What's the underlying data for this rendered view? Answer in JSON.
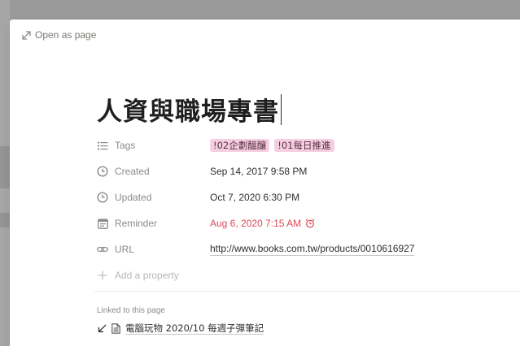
{
  "modal": {
    "open_as_page_label": "Open as page",
    "title": "人資與職場專書"
  },
  "properties": [
    {
      "name": "Tags",
      "icon": "list-icon"
    },
    {
      "name": "Created",
      "icon": "clock-icon",
      "value": "Sep 14, 2017 9:58 PM"
    },
    {
      "name": "Updated",
      "icon": "clock-icon",
      "value": "Oct 7, 2020 6:30 PM"
    },
    {
      "name": "Reminder",
      "icon": "calendar-icon",
      "value": "Aug 6, 2020 7:15 AM"
    },
    {
      "name": "URL",
      "icon": "link-icon",
      "value": "http://www.books.com.tw/products/0010616927"
    }
  ],
  "tags": [
    "!02企劃醞釀",
    "!01每日推進"
  ],
  "add_property_label": "Add a property",
  "linked": {
    "label": "Linked to this page",
    "item_title": "電腦玩物 2020/10 每週子彈筆記"
  },
  "colors": {
    "tag_pink": "#f5cfe0",
    "reminder_red": "#dc4a55",
    "muted_text": "#8d8b87"
  }
}
